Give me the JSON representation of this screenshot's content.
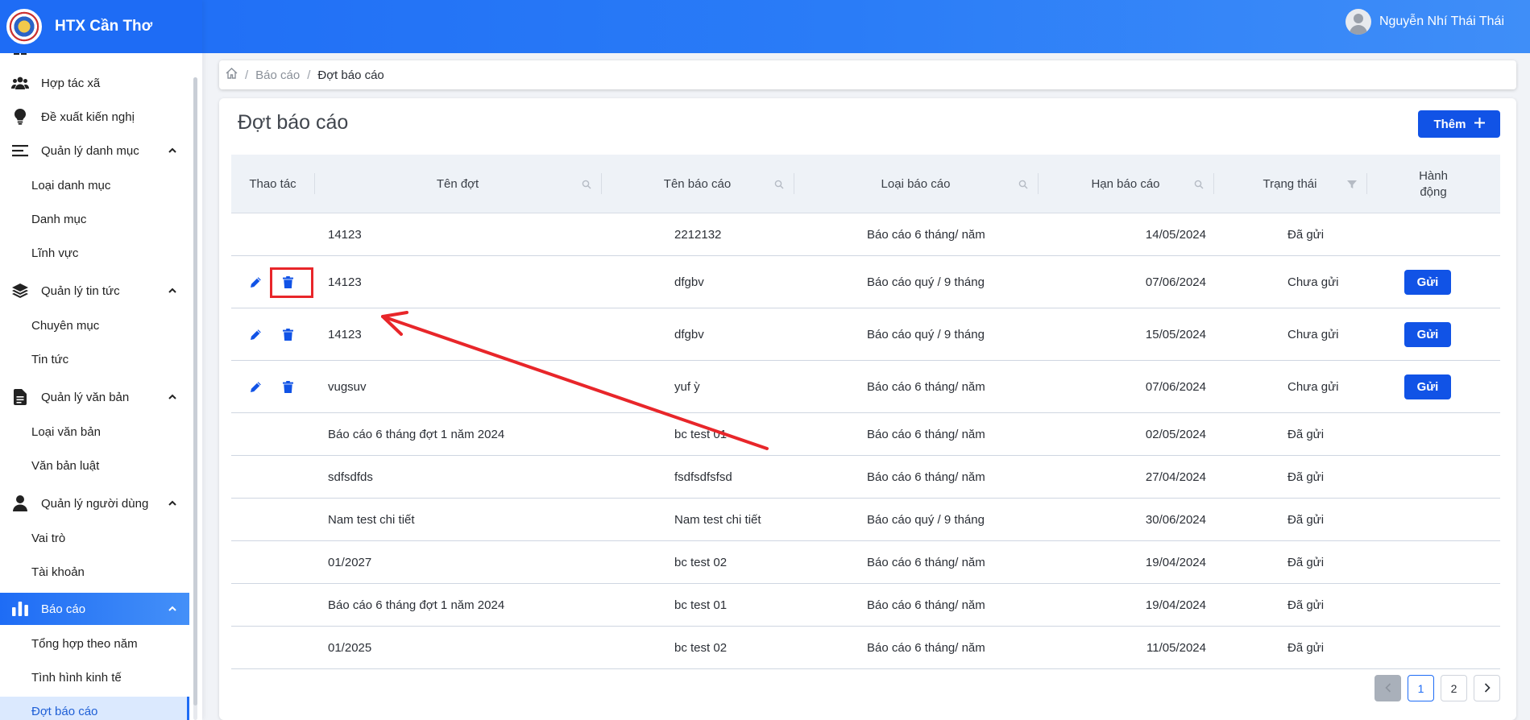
{
  "brand": {
    "name": "HTX Cần Thơ"
  },
  "user": {
    "name": "Nguyễn Nhí Thái Thái"
  },
  "sidebar": {
    "items": [
      {
        "label": "Hợp tác xã",
        "icon": "users-icon"
      },
      {
        "label": "Đề xuất kiến nghị",
        "icon": "lightbulb-icon"
      },
      {
        "label": "Quản lý danh mục",
        "icon": "list-icon"
      },
      {
        "label": "Loại danh mục"
      },
      {
        "label": "Danh mục"
      },
      {
        "label": "Lĩnh vực"
      },
      {
        "label": "Quản lý tin tức",
        "icon": "layers-icon"
      },
      {
        "label": "Chuyên mục"
      },
      {
        "label": "Tin tức"
      },
      {
        "label": "Quản lý văn bản",
        "icon": "document-icon"
      },
      {
        "label": "Loại văn bản"
      },
      {
        "label": "Văn bản luật"
      },
      {
        "label": "Quản lý người dùng",
        "icon": "user-icon"
      },
      {
        "label": "Vai trò"
      },
      {
        "label": "Tài khoản"
      },
      {
        "label": "Báo cáo",
        "icon": "bar-chart-icon"
      },
      {
        "label": "Tổng hợp theo năm"
      },
      {
        "label": "Tình hình kinh tế"
      },
      {
        "label": "Đợt báo cáo"
      }
    ]
  },
  "breadcrumb": {
    "home_icon": "home-icon",
    "parent": "Báo cáo",
    "current": "Đợt báo cáo"
  },
  "page": {
    "title": "Đợt báo cáo",
    "add_label": "Thêm"
  },
  "table": {
    "headers": {
      "thao_tac": "Thao tác",
      "ten_dot": "Tên đợt",
      "ten_bao_cao": "Tên báo cáo",
      "loai_bao_cao": "Loại báo cáo",
      "han_bao_cao": "Hạn báo cáo",
      "trang_thai": "Trạng thái",
      "hanh_dong_1": "Hành",
      "hanh_dong_2": "động"
    },
    "send_label": "Gửi",
    "rows": [
      {
        "ten_dot": "14123",
        "ten_bao_cao": "2212132",
        "loai": "Báo cáo 6 tháng/ năm",
        "han": "14/05/2024",
        "trang_thai": "Đã gửi"
      },
      {
        "ten_dot": "14123",
        "ten_bao_cao": "dfgbv",
        "loai": "Báo cáo quý / 9 tháng",
        "han": "07/06/2024",
        "trang_thai": "Chưa gửi"
      },
      {
        "ten_dot": "14123",
        "ten_bao_cao": "dfgbv",
        "loai": "Báo cáo quý / 9 tháng",
        "han": "15/05/2024",
        "trang_thai": "Chưa gửi"
      },
      {
        "ten_dot": "vugsuv",
        "ten_bao_cao": "yuf ỳ",
        "loai": "Báo cáo 6 tháng/ năm",
        "han": "07/06/2024",
        "trang_thai": "Chưa gửi"
      },
      {
        "ten_dot": "Báo cáo 6 tháng đợt 1 năm 2024",
        "ten_bao_cao": "bc test 01",
        "loai": "Báo cáo 6 tháng/ năm",
        "han": "02/05/2024",
        "trang_thai": "Đã gửi"
      },
      {
        "ten_dot": "sdfsdfds",
        "ten_bao_cao": "fsdfsdfsfsd",
        "loai": "Báo cáo 6 tháng/ năm",
        "han": "27/04/2024",
        "trang_thai": "Đã gửi"
      },
      {
        "ten_dot": "Nam test chi tiết",
        "ten_bao_cao": "Nam test chi tiết",
        "loai": "Báo cáo quý / 9 tháng",
        "han": "30/06/2024",
        "trang_thai": "Đã gửi"
      },
      {
        "ten_dot": "01/2027",
        "ten_bao_cao": "bc test 02",
        "loai": "Báo cáo 6 tháng/ năm",
        "han": "19/04/2024",
        "trang_thai": "Đã gửi"
      },
      {
        "ten_dot": "Báo cáo 6 tháng đợt 1 năm 2024",
        "ten_bao_cao": "bc test 01",
        "loai": "Báo cáo 6 tháng/ năm",
        "han": "19/04/2024",
        "trang_thai": "Đã gửi"
      },
      {
        "ten_dot": "01/2025",
        "ten_bao_cao": "bc test 02",
        "loai": "Báo cáo 6 tháng/ năm",
        "han": "11/05/2024",
        "trang_thai": "Đã gửi"
      }
    ]
  },
  "pagination": {
    "pages": [
      "1",
      "2"
    ],
    "current": "1"
  },
  "colors": {
    "primary": "#1e6cf5",
    "button": "#1153e6",
    "annotation": "#e8262a"
  }
}
